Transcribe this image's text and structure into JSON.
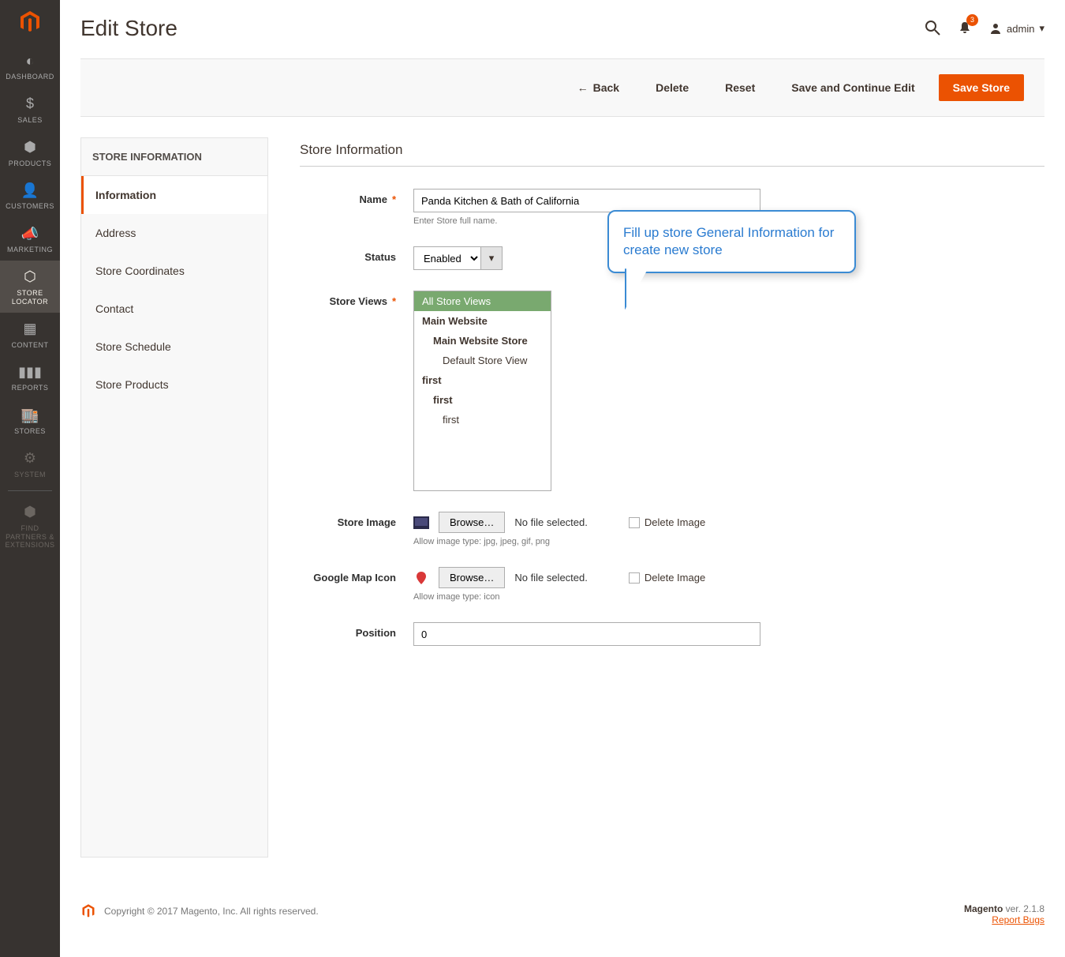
{
  "header": {
    "title": "Edit Store",
    "notification_count": "3",
    "username": "admin"
  },
  "toolbar": {
    "back": "Back",
    "delete": "Delete",
    "reset": "Reset",
    "save_continue": "Save and Continue Edit",
    "save": "Save Store"
  },
  "nav": [
    {
      "label": "DASHBOARD"
    },
    {
      "label": "SALES"
    },
    {
      "label": "PRODUCTS"
    },
    {
      "label": "CUSTOMERS"
    },
    {
      "label": "MARKETING"
    },
    {
      "label": "STORE LOCATOR"
    },
    {
      "label": "CONTENT"
    },
    {
      "label": "REPORTS"
    },
    {
      "label": "STORES"
    },
    {
      "label": "SYSTEM"
    },
    {
      "label": "FIND PARTNERS & EXTENSIONS"
    }
  ],
  "tabs": {
    "title": "STORE INFORMATION",
    "items": [
      "Information",
      "Address",
      "Store Coordinates",
      "Contact",
      "Store Schedule",
      "Store Products"
    ]
  },
  "form": {
    "title": "Store Information",
    "name_label": "Name",
    "name_value": "Panda Kitchen & Bath of California",
    "name_hint": "Enter Store full name.",
    "status_label": "Status",
    "status_value": "Enabled",
    "views_label": "Store Views",
    "views": {
      "all": "All Store Views",
      "main_site": "Main Website",
      "main_store": "Main Website Store",
      "default_view": "Default Store View",
      "first_site": "first",
      "first_store": "first",
      "first_view": "first"
    },
    "image_label": "Store Image",
    "browse": "Browse…",
    "no_file": "No file selected.",
    "delete_image": "Delete Image",
    "image_hint": "Allow image type: jpg, jpeg, gif, png",
    "map_icon_label": "Google Map Icon",
    "map_icon_hint": "Allow image type: icon",
    "position_label": "Position",
    "position_value": "0"
  },
  "callout": "Fill up store General Information for create new store",
  "footer": {
    "copyright": "Copyright © 2017 Magento, Inc. All rights reserved.",
    "brand": "Magento",
    "version": " ver. 2.1.8",
    "report": "Report Bugs"
  }
}
